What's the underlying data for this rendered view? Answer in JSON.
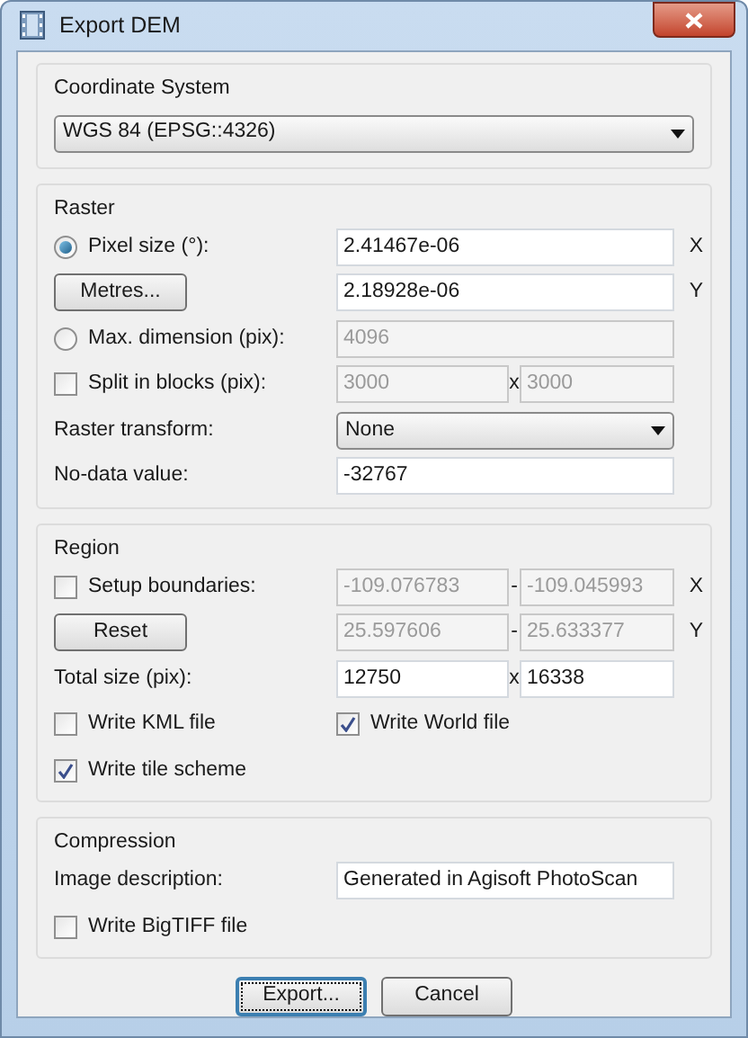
{
  "window": {
    "title": "Export DEM"
  },
  "coordinate_system": {
    "title": "Coordinate System",
    "value": "WGS 84 (EPSG::4326)"
  },
  "sections": [
    {
      "title": "Raster",
      "rows": [
        {
          "kind": "radio",
          "label": "Pixel size (°):",
          "selected": true,
          "fields": [
            {
              "value": "2.41467e-06",
              "disabled": false
            }
          ],
          "axis": "X"
        },
        {
          "kind": "button",
          "label": "Metres...",
          "fields": [
            {
              "value": "2.18928e-06",
              "disabled": false
            }
          ],
          "axis": "Y"
        },
        {
          "kind": "radio",
          "label": "Max. dimension (pix):",
          "selected": false,
          "fields": [
            {
              "value": "4096",
              "disabled": true
            }
          ]
        },
        {
          "kind": "checkbox",
          "label": "Split in blocks (pix):",
          "checked": false,
          "fields": [
            {
              "value": "3000",
              "disabled": true
            },
            {
              "value": "3000",
              "disabled": true
            }
          ],
          "separator": "x"
        },
        {
          "kind": "dropdown",
          "label": "Raster transform:",
          "value": "None"
        },
        {
          "kind": "text",
          "label": "No-data value:",
          "fields": [
            {
              "value": "-32767",
              "disabled": false
            }
          ]
        }
      ]
    },
    {
      "title": "Region",
      "rows": [
        {
          "kind": "checkbox",
          "label": "Setup boundaries:",
          "checked": false,
          "fields": [
            {
              "value": "-109.076783",
              "disabled": true
            },
            {
              "value": "-109.045993",
              "disabled": true
            }
          ],
          "separator": "-",
          "axis": "X"
        },
        {
          "kind": "button",
          "label": "Reset",
          "fields": [
            {
              "value": "25.597606",
              "disabled": true
            },
            {
              "value": "25.633377",
              "disabled": true
            }
          ],
          "separator": "-",
          "axis": "Y"
        },
        {
          "kind": "text",
          "label": "Total size (pix):",
          "fields": [
            {
              "value": "12750",
              "disabled": false
            },
            {
              "value": "16338",
              "disabled": false
            }
          ],
          "separator": "x"
        },
        {
          "kind": "checks",
          "items": [
            {
              "label": "Write KML file",
              "checked": false
            },
            {
              "label": "Write World file",
              "checked": true
            }
          ]
        },
        {
          "kind": "checks",
          "items": [
            {
              "label": "Write tile scheme",
              "checked": true
            }
          ]
        }
      ]
    },
    {
      "title": "Compression",
      "rows": [
        {
          "kind": "text",
          "label": "Image description:",
          "fields": [
            {
              "value": "Generated in Agisoft PhotoScan",
              "disabled": false
            }
          ]
        },
        {
          "kind": "checks",
          "items": [
            {
              "label": "Write BigTIFF file",
              "checked": false
            }
          ]
        }
      ]
    }
  ],
  "buttons": [
    {
      "label": "Export...",
      "default": true
    },
    {
      "label": "Cancel",
      "default": false
    }
  ]
}
